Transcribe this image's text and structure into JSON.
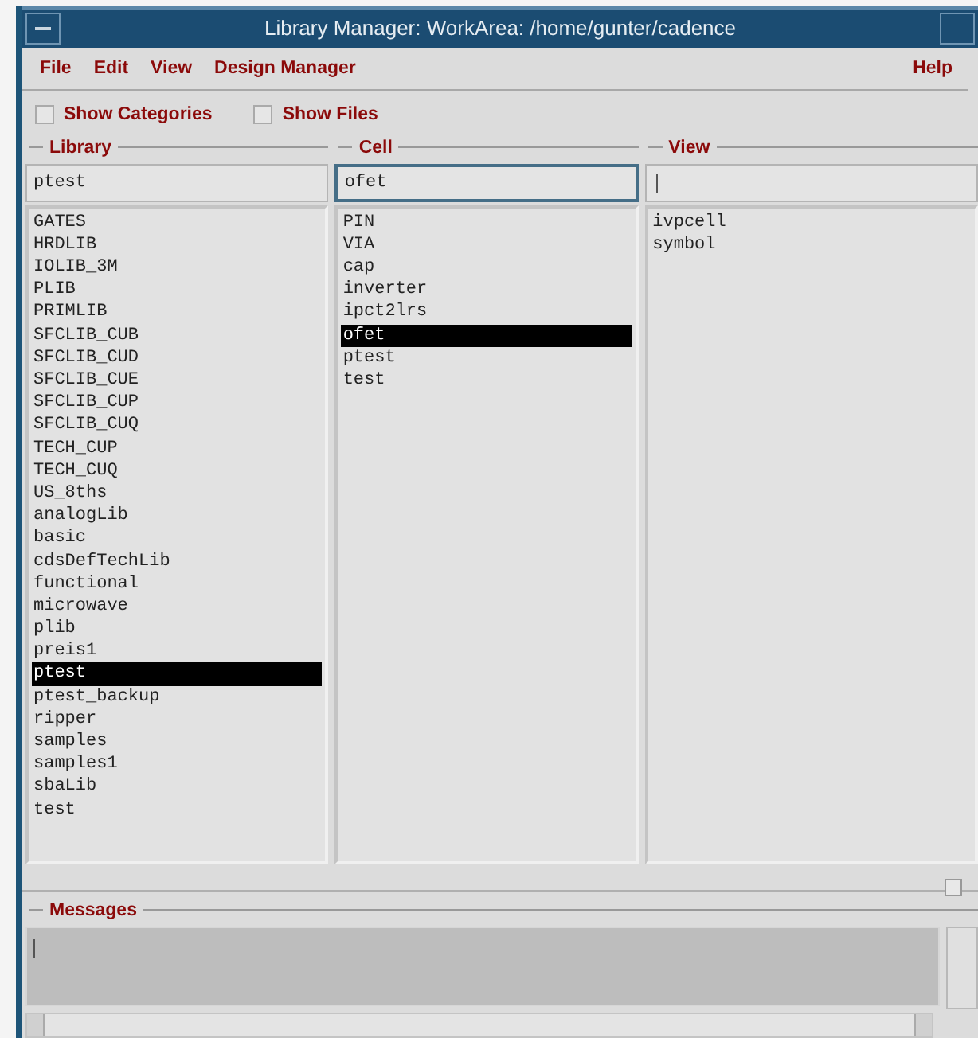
{
  "window": {
    "title": "Library Manager: WorkArea: /home/gunter/cadence"
  },
  "menu": [
    {
      "label": "File"
    },
    {
      "label": "Edit"
    },
    {
      "label": "View"
    },
    {
      "label": "Design Manager"
    }
  ],
  "help_menu": {
    "label": "Help"
  },
  "options": [
    {
      "label": "Show Categories",
      "checked": false
    },
    {
      "label": "Show Files",
      "checked": false
    }
  ],
  "columns": [
    {
      "title": "Library",
      "value": "ptest",
      "focused": false,
      "items": [
        {
          "label": "GATES",
          "selected": false
        },
        {
          "label": "HRDLIB",
          "selected": false
        },
        {
          "label": "IOLIB_3M",
          "selected": false
        },
        {
          "label": "PLIB",
          "selected": false
        },
        {
          "label": "PRIMLIB",
          "selected": false
        },
        {
          "label": "SFCLIB_CUB",
          "selected": false
        },
        {
          "label": "SFCLIB_CUD",
          "selected": false
        },
        {
          "label": "SFCLIB_CUE",
          "selected": false
        },
        {
          "label": "SFCLIB_CUP",
          "selected": false
        },
        {
          "label": "SFCLIB_CUQ",
          "selected": false
        },
        {
          "label": "TECH_CUP",
          "selected": false
        },
        {
          "label": "TECH_CUQ",
          "selected": false
        },
        {
          "label": "US_8ths",
          "selected": false
        },
        {
          "label": "analogLib",
          "selected": false
        },
        {
          "label": "basic",
          "selected": false
        },
        {
          "label": "cdsDefTechLib",
          "selected": false
        },
        {
          "label": "functional",
          "selected": false
        },
        {
          "label": "microwave",
          "selected": false
        },
        {
          "label": "plib",
          "selected": false
        },
        {
          "label": "preis1",
          "selected": false
        },
        {
          "label": "ptest",
          "selected": true
        },
        {
          "label": "ptest_backup",
          "selected": false
        },
        {
          "label": "ripper",
          "selected": false
        },
        {
          "label": "samples",
          "selected": false
        },
        {
          "label": "samples1",
          "selected": false
        },
        {
          "label": "sbaLib",
          "selected": false
        },
        {
          "label": "test",
          "selected": false
        }
      ]
    },
    {
      "title": "Cell",
      "value": "ofet",
      "focused": true,
      "items": [
        {
          "label": "PIN",
          "selected": false
        },
        {
          "label": "VIA",
          "selected": false
        },
        {
          "label": "cap",
          "selected": false
        },
        {
          "label": "inverter",
          "selected": false
        },
        {
          "label": "ipct2lrs",
          "selected": false
        },
        {
          "label": "ofet",
          "selected": true
        },
        {
          "label": "ptest",
          "selected": false
        },
        {
          "label": "test",
          "selected": false
        }
      ]
    },
    {
      "title": "View",
      "focused": false,
      "items": [
        {
          "label": "ivpcell",
          "selected": false
        },
        {
          "label": "symbol",
          "selected": false
        }
      ]
    }
  ],
  "messages": {
    "title": "Messages"
  }
}
